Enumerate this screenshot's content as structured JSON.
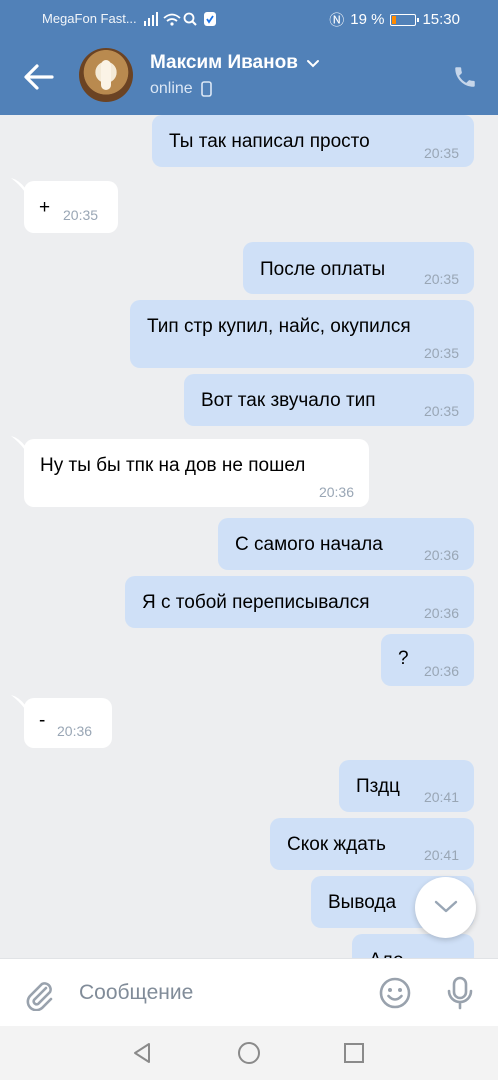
{
  "status_bar": {
    "carrier": "MegaFon Fast...",
    "battery": "19 %",
    "time": "15:30"
  },
  "header": {
    "contact_name": "Максим Иванов",
    "presence": "online"
  },
  "messages": [
    {
      "dir": "out",
      "text": "Ты так написал просто",
      "time": "20:35"
    },
    {
      "dir": "in",
      "text": "+",
      "time": "20:35"
    },
    {
      "dir": "out",
      "text": "После оплаты",
      "time": "20:35"
    },
    {
      "dir": "out",
      "text": "Тип стр купил, найс, окупился",
      "time": "20:35"
    },
    {
      "dir": "out",
      "text": "Вот так звучало тип",
      "time": "20:35"
    },
    {
      "dir": "in",
      "text": "Ну ты бы тпк на дов не пошел",
      "time": "20:36"
    },
    {
      "dir": "out",
      "text": "С самого начала",
      "time": "20:36"
    },
    {
      "dir": "out",
      "text": "Я с тобой переписывался",
      "time": "20:36"
    },
    {
      "dir": "out",
      "text": "?",
      "time": "20:36"
    },
    {
      "dir": "in",
      "text": "-",
      "time": "20:36"
    },
    {
      "dir": "out",
      "text": "Пздц",
      "time": "20:41"
    },
    {
      "dir": "out",
      "text": "Скок ждать",
      "time": "20:41"
    },
    {
      "dir": "out",
      "text": "Вывода",
      "time": ""
    },
    {
      "dir": "out",
      "text": "Ало",
      "time": ""
    }
  ],
  "composer": {
    "placeholder": "Сообщение"
  },
  "icons": {
    "back": "arrow-left-icon",
    "phone": "phone-icon",
    "attach": "paperclip-icon",
    "emoji": "smile-icon",
    "mic": "microphone-icon",
    "scroll": "chevron-down-icon"
  },
  "colors": {
    "header": "#5181b8",
    "outgoing_bubble": "#cfe0f7",
    "incoming_bubble": "#ffffff",
    "chat_background": "#edeef0"
  }
}
